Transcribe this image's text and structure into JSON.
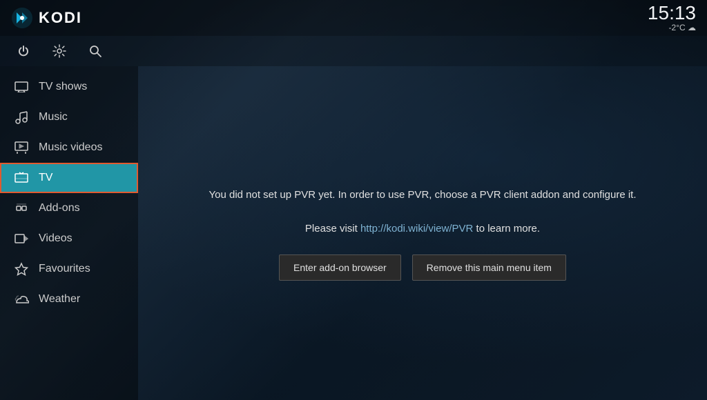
{
  "app": {
    "title": "KODI"
  },
  "time": {
    "display": "15:13",
    "weather": "-2°C ☁"
  },
  "controls": [
    {
      "id": "power",
      "label": "Power",
      "symbol": "⏻"
    },
    {
      "id": "settings",
      "label": "Settings",
      "symbol": "⚙"
    },
    {
      "id": "search",
      "label": "Search",
      "symbol": "🔍"
    }
  ],
  "sidebar": {
    "items": [
      {
        "id": "tv-shows",
        "label": "TV shows",
        "icon": "tv",
        "active": false
      },
      {
        "id": "music",
        "label": "Music",
        "icon": "music",
        "active": false
      },
      {
        "id": "music-videos",
        "label": "Music videos",
        "icon": "music-video",
        "active": false
      },
      {
        "id": "tv",
        "label": "TV",
        "icon": "tv-antenna",
        "active": true
      },
      {
        "id": "add-ons",
        "label": "Add-ons",
        "icon": "addon",
        "active": false
      },
      {
        "id": "videos",
        "label": "Videos",
        "icon": "video",
        "active": false
      },
      {
        "id": "favourites",
        "label": "Favourites",
        "icon": "star",
        "active": false
      },
      {
        "id": "weather",
        "label": "Weather",
        "icon": "weather",
        "active": false
      }
    ]
  },
  "content": {
    "pvr_message": "You did not set up PVR yet. In order to use PVR, choose a PVR client addon and configure it.\nPlease visit http://kodi.wiki/view/PVR to learn more.",
    "pvr_message_line1": "You did not set up PVR yet. In order to use PVR, choose a PVR client addon and configure it.",
    "pvr_message_line2": "Please visit http://kodi.wiki/view/PVR to learn more.",
    "button_addon_browser": "Enter add-on browser",
    "button_remove": "Remove this main menu item"
  }
}
